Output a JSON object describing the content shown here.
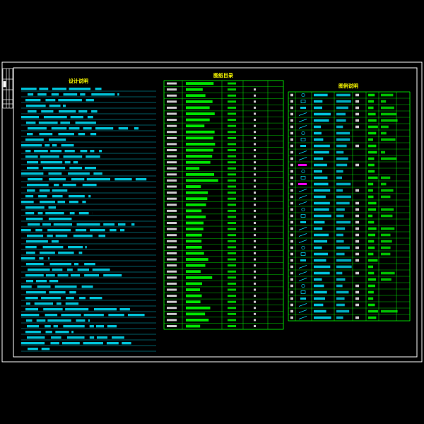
{
  "colors": {
    "background": "#000000",
    "frame": "#ffffff",
    "text_cyan": "#00e5ff",
    "table_green": "#00ff00",
    "title_yellow": "#ffff00",
    "symbol_magenta": "#ff00ff",
    "text_white": "#ffffff"
  },
  "notes_panel": {
    "title": "设计说明",
    "line_count": 47
  },
  "index_panel": {
    "title": "图纸目录",
    "row_count": 41
  },
  "legend_panel": {
    "title": "图例说明",
    "row_count": 36
  }
}
